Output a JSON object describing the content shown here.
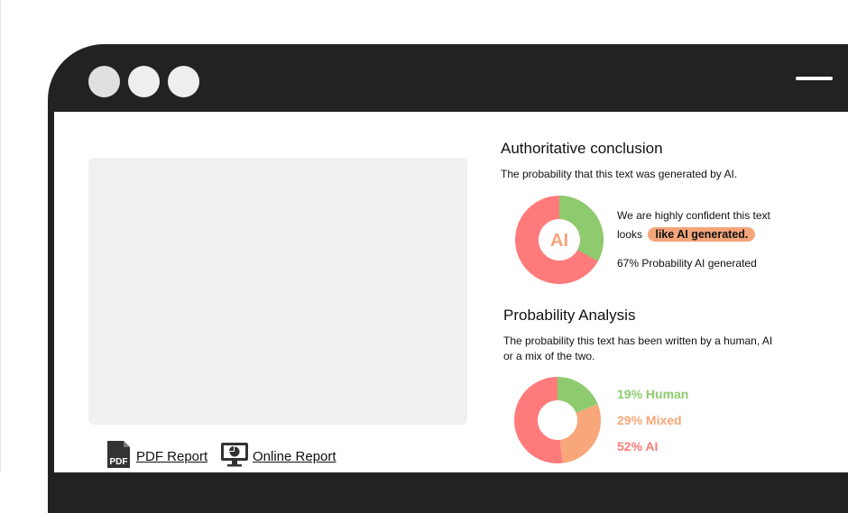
{
  "window": {
    "dots": [
      "#e0e0e0",
      "#eeeeee",
      "#eeeeee"
    ],
    "frame_color": "#222222"
  },
  "reports": {
    "pdf_label": "PDF Report",
    "pdf_icon_text": "PDF",
    "online_label": "Online Report"
  },
  "conclusion": {
    "title": "Authoritative conclusion",
    "description": "The probability that this text was generated by AI.",
    "donut_center": "AI",
    "donut_ai_percent": 67,
    "confidence_line1": "We are highly confident this text",
    "confidence_prefix": "looks",
    "confidence_badge": "like AI generated.",
    "probability_text": "67% Probability AI generated"
  },
  "analysis": {
    "title": "Probability Analysis",
    "description_line1": "The probability this text has been written by a human, AI",
    "description_line2": "or a mix of the two.",
    "segments": [
      {
        "label": "19% Human",
        "percent": 19,
        "color": "#8ecb6e"
      },
      {
        "label": "29% Mixed",
        "percent": 29,
        "color": "#f7a77a"
      },
      {
        "label": "52% AI",
        "percent": 52,
        "color": "#ff7b7b"
      }
    ]
  },
  "colors": {
    "ai": "#ff7b7b",
    "human": "#8ecb6e",
    "mixed": "#f7a77a",
    "center_text": "#f4a57b"
  }
}
